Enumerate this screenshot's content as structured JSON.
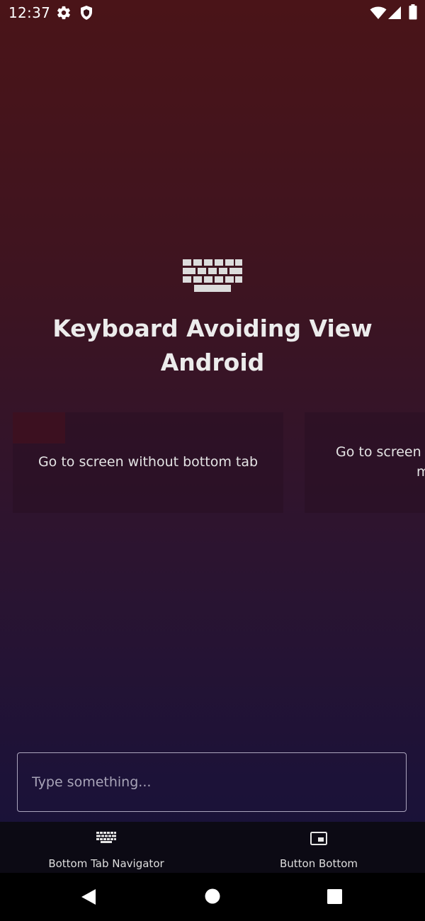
{
  "status_bar": {
    "time": "12:37",
    "icons": [
      "gear-icon",
      "shield-icon",
      "wifi-icon",
      "signal-icon",
      "battery-icon"
    ]
  },
  "hero": {
    "icon": "keyboard-icon",
    "title": "Keyboard Avoiding View Android"
  },
  "cards": [
    {
      "label": "Go to screen without bottom tab"
    },
    {
      "label_line1": "Go to screen",
      "label_line2": "m"
    }
  ],
  "input": {
    "placeholder": "Type something...",
    "value": ""
  },
  "tabs": [
    {
      "label": "Bottom Tab Navigator",
      "icon": "keyboard-icon"
    },
    {
      "label": "Button Bottom",
      "icon": "picture-in-picture-icon"
    }
  ],
  "nav_bar": {
    "icons": [
      "back-icon",
      "home-icon",
      "recents-icon"
    ]
  },
  "colors": {
    "background_top": "#4a1418",
    "background_bottom": "#16103a",
    "text": "#ececec",
    "tab_bar": "#0c0a14"
  }
}
